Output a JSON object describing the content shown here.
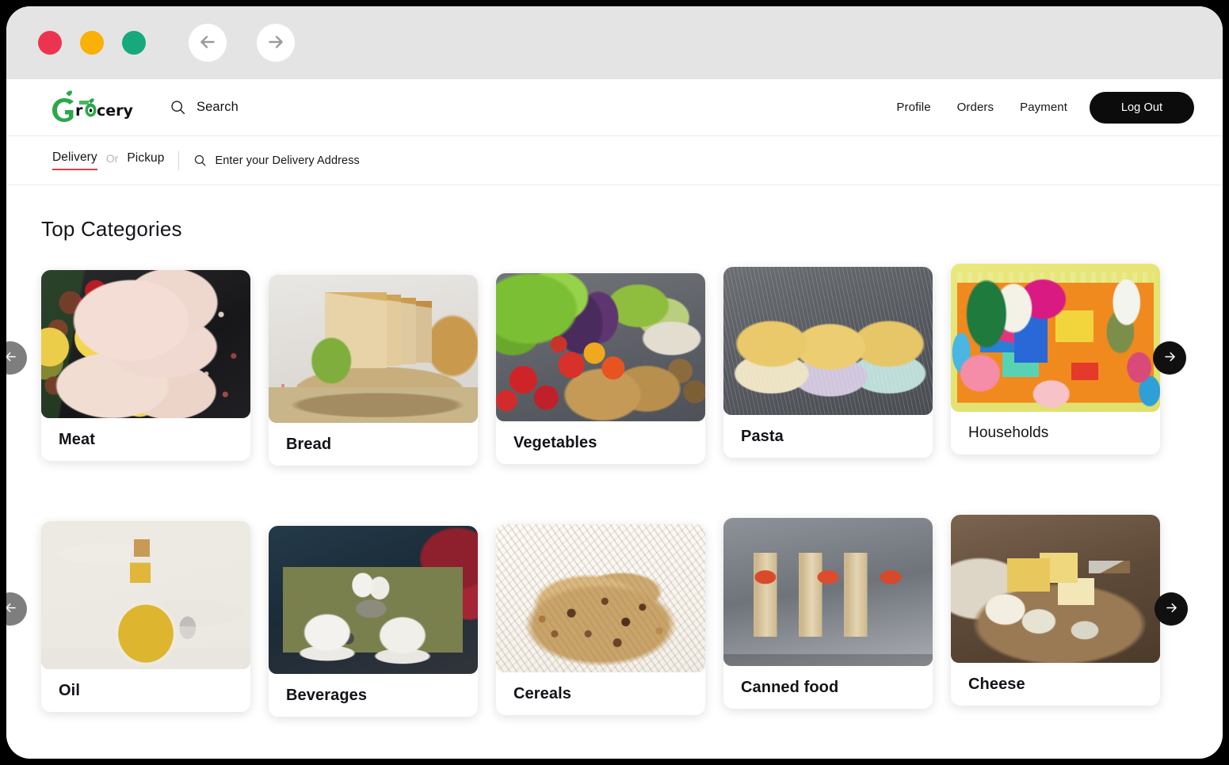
{
  "window": {
    "traffic_lights": [
      {
        "name": "close",
        "color": "#ec3450"
      },
      {
        "name": "minimize",
        "color": "#fab005"
      },
      {
        "name": "maximize",
        "color": "#16a97b"
      }
    ],
    "back_label": "Back",
    "forward_label": "Forward"
  },
  "header": {
    "brand": "Grocery",
    "search": {
      "placeholder": "Search"
    },
    "nav": [
      {
        "label": "Profile"
      },
      {
        "label": "Orders"
      },
      {
        "label": "Payment"
      }
    ],
    "logout_label": "Log Out"
  },
  "delivery": {
    "tab_delivery": "Delivery",
    "or": "Or",
    "tab_pickup": "Pickup",
    "address_placeholder": "Enter your Delivery Address",
    "active_tab": "Delivery",
    "accent_color": "#e03a45"
  },
  "main": {
    "section_title": "Top Categories",
    "rows": [
      {
        "cards": [
          {
            "label": "Meat",
            "image": "img-meat",
            "weight": "bold"
          },
          {
            "label": "Bread",
            "image": "img-bread",
            "weight": "bold"
          },
          {
            "label": "Vegetables",
            "image": "img-veg",
            "weight": "bold"
          },
          {
            "label": "Pasta",
            "image": "img-pasta",
            "weight": "bold"
          },
          {
            "label": "Households",
            "image": "img-house",
            "weight": "light"
          }
        ]
      },
      {
        "cards": [
          {
            "label": "Oil",
            "image": "img-oil",
            "weight": "bold"
          },
          {
            "label": "Beverages",
            "image": "img-bev",
            "weight": "bold"
          },
          {
            "label": "Cereals",
            "image": "img-cereal",
            "weight": "bold"
          },
          {
            "label": "Canned food",
            "image": "img-canned",
            "weight": "bold"
          },
          {
            "label": "Cheese",
            "image": "img-cheese",
            "weight": "bold"
          }
        ]
      }
    ],
    "carousel_prev_label": "Previous",
    "carousel_next_label": "Next"
  }
}
